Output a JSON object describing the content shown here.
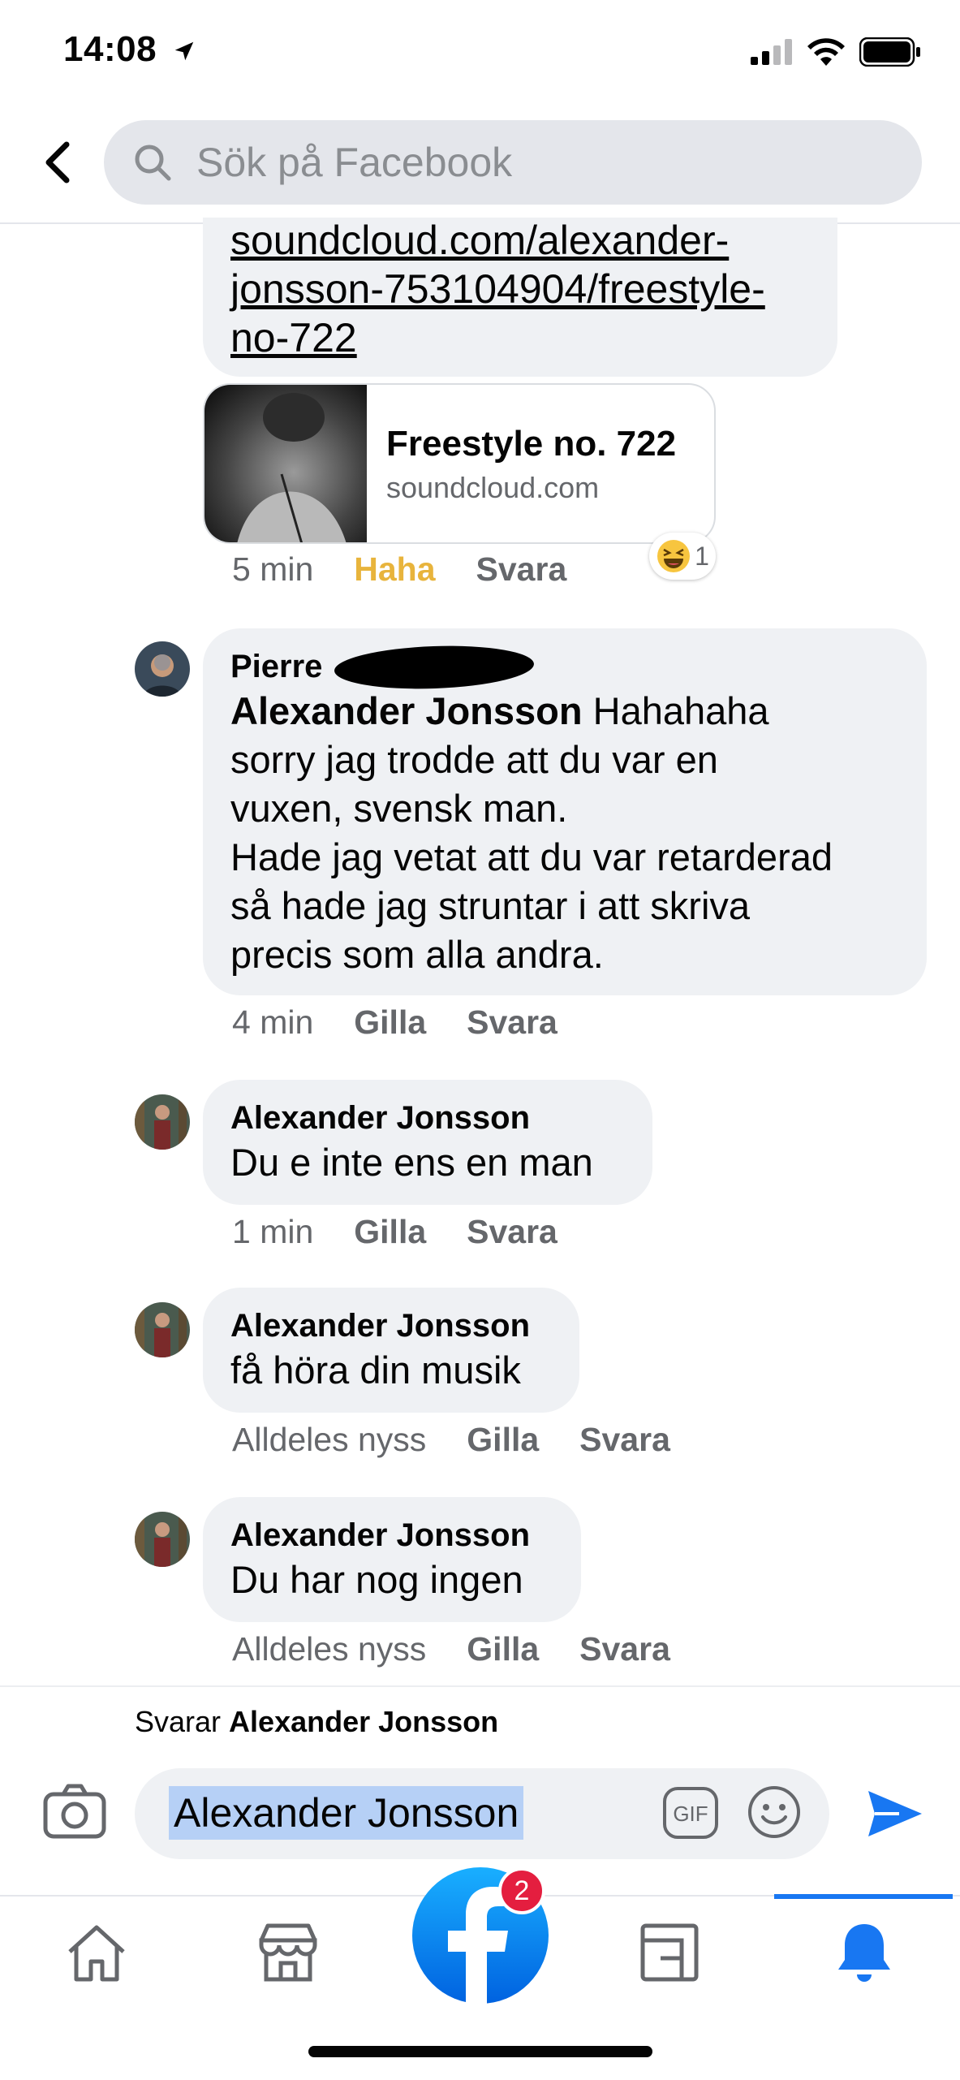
{
  "status_bar": {
    "time": "14:08"
  },
  "search": {
    "placeholder": "Sök på Facebook"
  },
  "link_comment": {
    "link_text": "soundcloud.com/alexander-jonsson-753104904/freestyle-no-722",
    "link_lines": [
      "soundcloud.com/alexander-",
      "jonsson-753104904/freestyle-",
      "no-722"
    ],
    "card_title": "Freestyle no. 722",
    "card_domain": "soundcloud.com",
    "time": "5 min",
    "reaction_label": "Haha",
    "reply_label": "Svara",
    "reaction_count": "1",
    "colors": {
      "haha": "#e8b43c"
    }
  },
  "comments": [
    {
      "author": "Pierre",
      "mention": "Alexander Jonsson",
      "text_line1": " Hahahaha",
      "lines": [
        "sorry jag trodde att du var en",
        "vuxen, svensk man.",
        "Hade jag vetat att du var retarderad",
        "så hade jag struntar i att skriva",
        "precis som alla andra."
      ],
      "time": "4 min",
      "like": "Gilla",
      "reply": "Svara"
    },
    {
      "author": "Alexander Jonsson",
      "text": "Du e inte ens en man",
      "time": "1 min",
      "like": "Gilla",
      "reply": "Svara"
    },
    {
      "author": "Alexander Jonsson",
      "text": "få höra din musik",
      "time": "Alldeles nyss",
      "like": "Gilla",
      "reply": "Svara"
    },
    {
      "author": "Alexander Jonsson",
      "text": "Du har nog ingen",
      "time": "Alldeles nyss",
      "like": "Gilla",
      "reply": "Svara"
    }
  ],
  "reply_bar": {
    "prefix": "Svarar ",
    "target": "Alexander Jonsson",
    "input_value": "Alexander Jonsson",
    "gif_label": "GIF"
  },
  "tabbar": {
    "notification_badge": "2",
    "active_color": "#1877f2"
  }
}
